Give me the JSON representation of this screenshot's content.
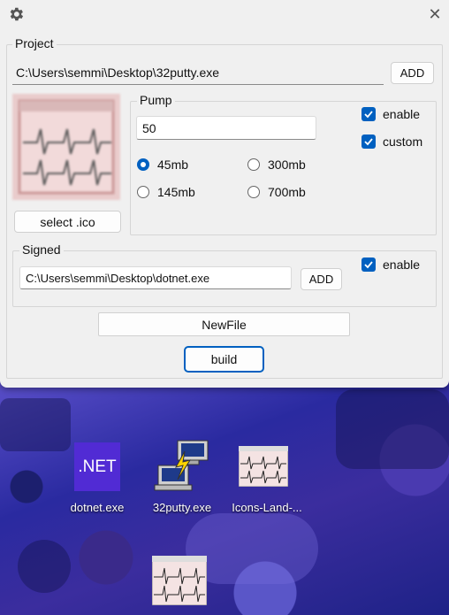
{
  "window": {
    "close_glyph": "✕"
  },
  "project": {
    "legend": "Project",
    "path": "C:\\Users\\semmi\\Desktop\\32putty.exe",
    "add_label": "ADD"
  },
  "icon_preview": {
    "select_label": "select .ico"
  },
  "pump": {
    "legend": "Pump",
    "value": "50",
    "enable_label": "enable",
    "enable_checked": true,
    "custom_label": "custom",
    "custom_checked": true,
    "options": [
      {
        "label": "45mb",
        "selected": true
      },
      {
        "label": "300mb",
        "selected": false
      },
      {
        "label": "145mb",
        "selected": false
      },
      {
        "label": "700mb",
        "selected": false
      }
    ]
  },
  "signed": {
    "legend": "Signed",
    "path": "C:\\Users\\semmi\\Desktop\\dotnet.exe",
    "add_label": "ADD",
    "enable_label": "enable",
    "enable_checked": true
  },
  "actions": {
    "newfile_label": "NewFile",
    "build_label": "build"
  },
  "desktop": {
    "icons": [
      {
        "name": "dotnet-exe",
        "label": "dotnet.exe",
        "badge": ".NET"
      },
      {
        "name": "putty-exe",
        "label": "32putty.exe"
      },
      {
        "name": "icons-land",
        "label": "Icons-Land-..."
      }
    ]
  },
  "colors": {
    "accent": "#0060c0",
    "window_bg": "#f0f0f0",
    "net_badge": "#512bd4"
  }
}
